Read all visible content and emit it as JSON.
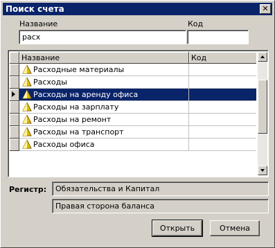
{
  "window": {
    "title": "Поиск счета",
    "close_label": "✕"
  },
  "filters": {
    "name_label": "Название",
    "name_value": "расх",
    "code_label": "Код",
    "code_value": ""
  },
  "grid": {
    "columns": [
      "Название",
      "Код"
    ],
    "selected_index": 2,
    "rows": [
      {
        "name": "Расходные материалы",
        "code": ""
      },
      {
        "name": "Расходы",
        "code": ""
      },
      {
        "name": "Расходы на аренду офиса",
        "code": ""
      },
      {
        "name": "Расходы на зарплату",
        "code": ""
      },
      {
        "name": "Расходы на ремонт",
        "code": ""
      },
      {
        "name": "Расходы на транспорт",
        "code": ""
      },
      {
        "name": "Расходы офиса",
        "code": ""
      }
    ]
  },
  "register": {
    "label": "Регистр:",
    "value1": "Обязательства и Капитал",
    "value2": "Правая сторона баланса"
  },
  "buttons": {
    "open": "Открыть",
    "cancel": "Отмена"
  },
  "colors": {
    "titlebar": "#0a246a",
    "selection": "#0a246a",
    "face": "#d4d0c8"
  }
}
